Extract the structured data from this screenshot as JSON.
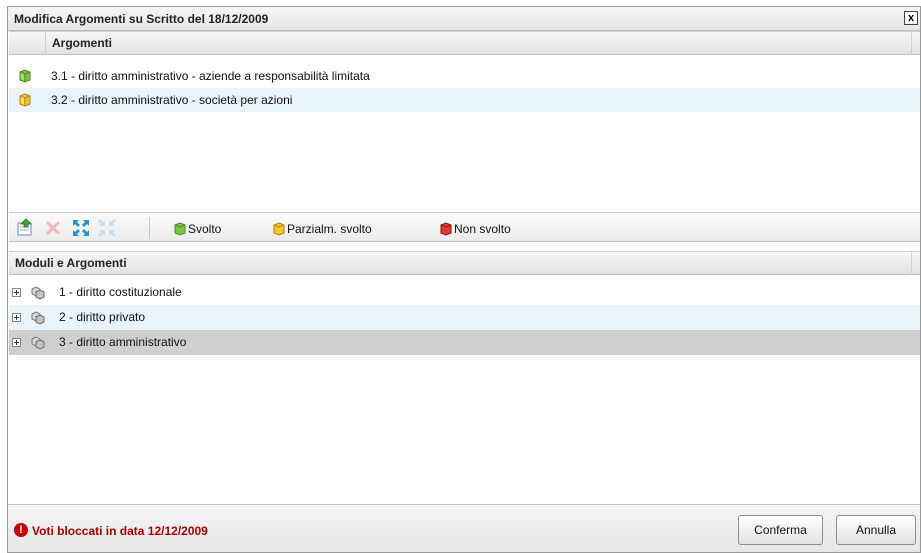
{
  "dialog": {
    "title": "Modifica Argomenti su Scritto del 18/12/2009",
    "close_label": "x"
  },
  "argomenti": {
    "header": "Argomenti",
    "rows": [
      {
        "text": "3.1 - diritto amministrativo - aziende a responsabilità limitata",
        "status_icon": "cube-green-icon",
        "color": "#7ec24a"
      },
      {
        "text": "3.2 - diritto amministrativo - società per azioni",
        "status_icon": "cube-yellow-icon",
        "color": "#f5c431"
      }
    ]
  },
  "toolbar": {
    "buttons": [
      {
        "name": "add-icon",
        "enabled": true
      },
      {
        "name": "delete-icon",
        "enabled": false
      },
      {
        "name": "expand-all-icon",
        "enabled": true
      },
      {
        "name": "collapse-all-icon",
        "enabled": false
      }
    ],
    "legend": {
      "svolto": "Svolto",
      "parzialm_svolto": "Parzialm. svolto",
      "non_svolto": "Non svolto"
    },
    "colors": {
      "svolto": "#7ec24a",
      "parzialm_svolto": "#f5c431",
      "non_svolto": "#e0383b"
    }
  },
  "moduli": {
    "header": "Moduli e Argomenti",
    "rows": [
      {
        "text": "1 - diritto costituzionale"
      },
      {
        "text": "2 - diritto privato"
      },
      {
        "text": "3 - diritto amministrativo"
      }
    ]
  },
  "footer": {
    "alert_text": "Voti bloccati in data 12/12/2009",
    "confirm_label": "Conferma",
    "cancel_label": "Annulla"
  }
}
